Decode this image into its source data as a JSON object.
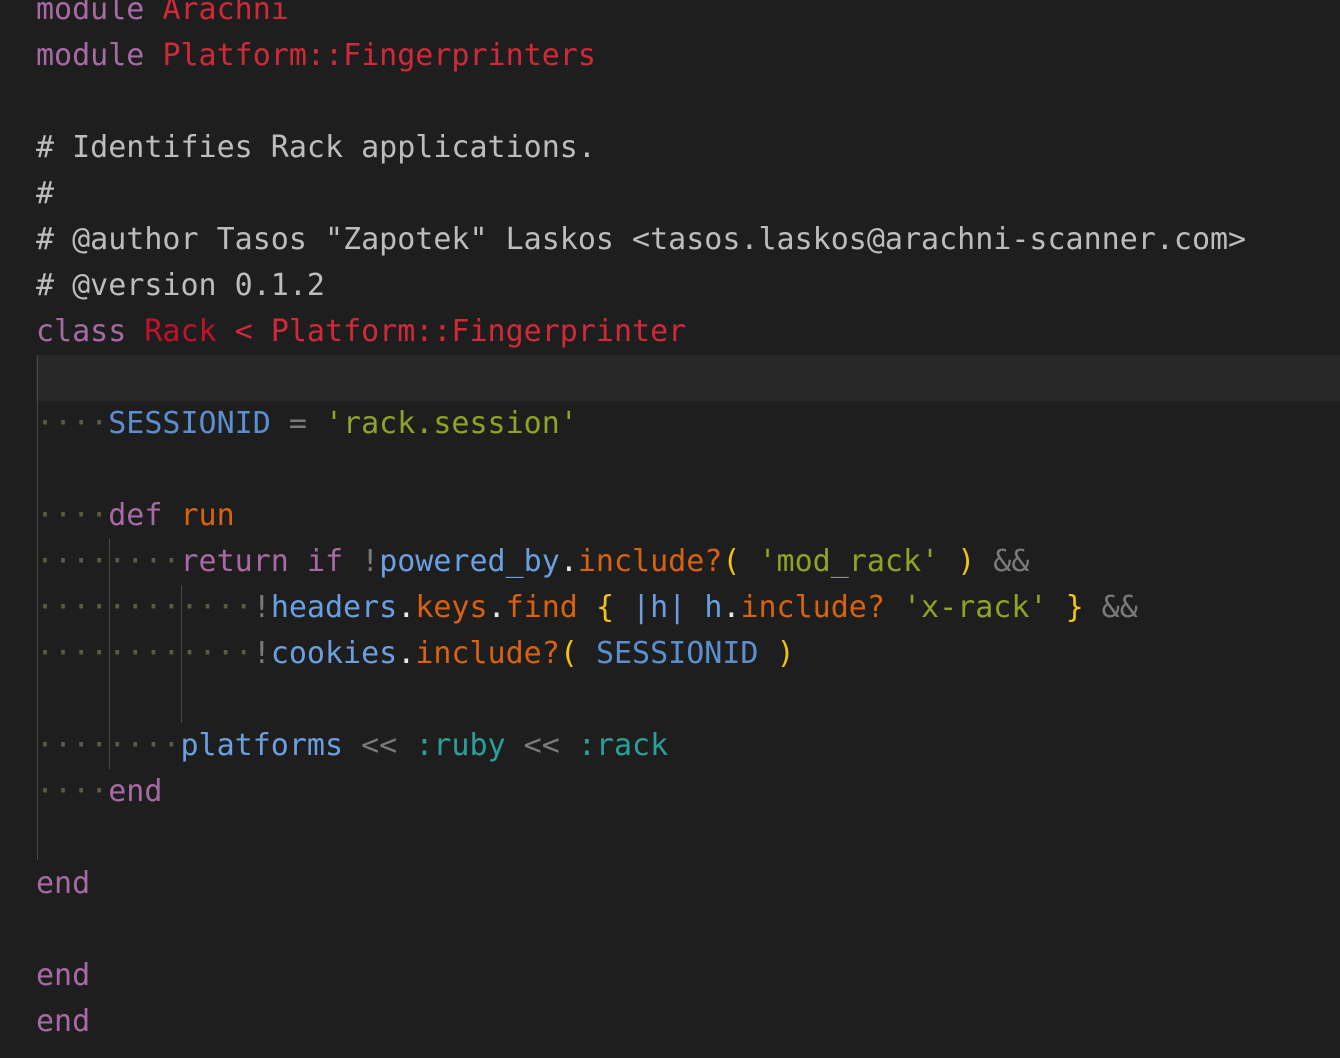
{
  "editor": {
    "language": "ruby",
    "theme_colors": {
      "background": "#1e1e1e",
      "keyword": "#a86aa4",
      "namespace": "#d02a3a",
      "comment": "#bdbdbd",
      "constant": "#5b8fcf",
      "string": "#8da426",
      "method": "#d8620f",
      "symbol": "#2aa198",
      "brace": "#f1c40f"
    },
    "lines": {
      "l1": {
        "t0": "module",
        "t1": " ",
        "t2": "Arachni"
      },
      "l2": {
        "t0": "module",
        "t1": " ",
        "t2": "Platform::",
        "t3": "Fingerprinters"
      },
      "l4": {
        "t0": "# Identifies Rack applications."
      },
      "l5": {
        "t0": "#"
      },
      "l6": {
        "t0": "# @author Tasos \"Zapotek\" Laskos <tasos.laskos@arachni-scanner.com>"
      },
      "l7": {
        "t0": "# @version 0.1.2"
      },
      "l8": {
        "t0": "class",
        "t1": " ",
        "t2": "Rack",
        "t3": " < ",
        "t4": "Platform::Fingerprinter"
      },
      "l10": {
        "ws": "····",
        "t0": "SESSIONID",
        "t1": " = ",
        "t2": "'rack.session'"
      },
      "l12": {
        "ws": "····",
        "t0": "def",
        "t1": " ",
        "t2": "run"
      },
      "l13": {
        "ws": "········",
        "t0": "return",
        "t1": " ",
        "t2": "if",
        "t3": " !",
        "t4": "powered_by",
        "t5": ".",
        "t6": "include?",
        "t7": "(",
        "t8": " ",
        "t9": "'mod_rack'",
        "t10": " ",
        "t11": ")",
        "t12": " &&"
      },
      "l14": {
        "ws": "············",
        "t0": "!",
        "t1": "headers",
        "t2": ".",
        "t3": "keys",
        "t4": ".",
        "t5": "find",
        "t6": " ",
        "t7": "{",
        "t8": " ",
        "t9": "|h|",
        "t10": " ",
        "t11": "h",
        "t12": ".",
        "t13": "include?",
        "t14": " ",
        "t15": "'x-rack'",
        "t16": " ",
        "t17": "}",
        "t18": " &&"
      },
      "l15": {
        "ws": "············",
        "t0": "!",
        "t1": "cookies",
        "t2": ".",
        "t3": "include?",
        "t4": "(",
        "t5": " ",
        "t6": "SESSIONID",
        "t7": " ",
        "t8": ")"
      },
      "l17": {
        "ws": "········",
        "t0": "platforms",
        "t1": " << ",
        "t2": ":ruby",
        "t3": " << ",
        "t4": ":rack"
      },
      "l18": {
        "ws": "····",
        "t0": "end"
      },
      "l20": {
        "t0": "end"
      },
      "l22": {
        "t0": "end"
      },
      "l23": {
        "t0": "end"
      }
    }
  }
}
